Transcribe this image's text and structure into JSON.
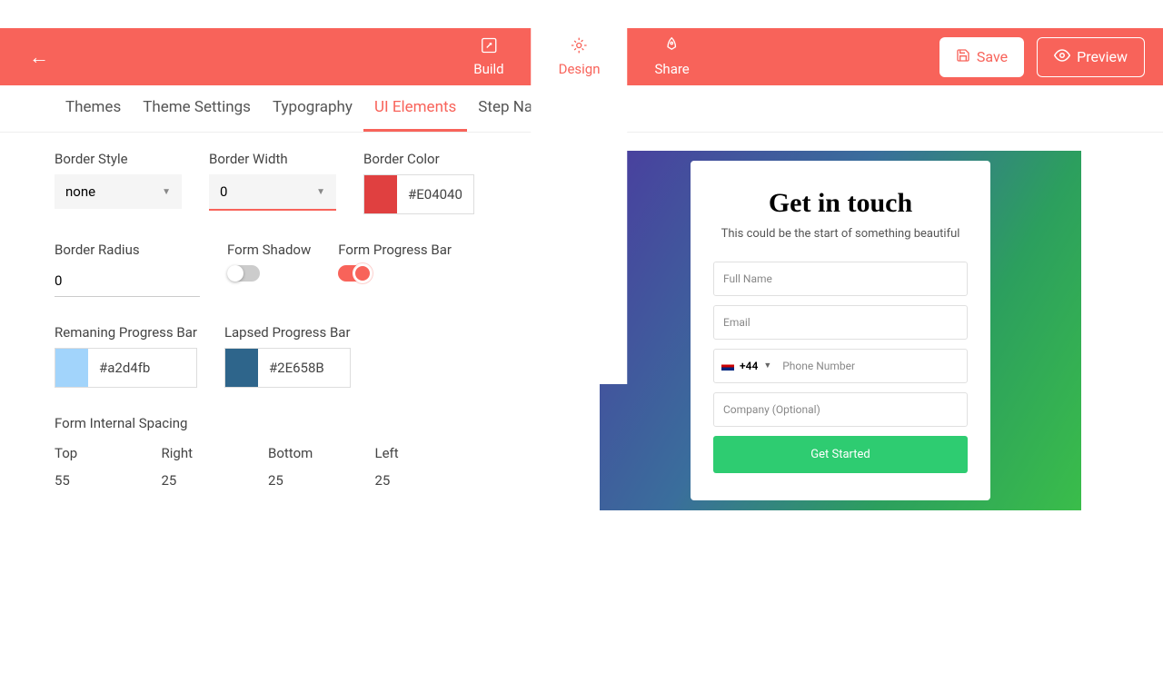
{
  "topbar": {
    "tabs": [
      {
        "label": "Build"
      },
      {
        "label": "Design"
      },
      {
        "label": "Share"
      }
    ],
    "save": "Save",
    "preview": "Preview"
  },
  "subnav": {
    "items": [
      "Themes",
      "Theme Settings",
      "Typography",
      "UI Elements",
      "Step Navigation"
    ]
  },
  "settings": {
    "border_style": {
      "label": "Border Style",
      "value": "none"
    },
    "border_width": {
      "label": "Border Width",
      "value": "0"
    },
    "border_color": {
      "label": "Border Color",
      "swatch": "#E04040",
      "value": "#E04040"
    },
    "border_radius": {
      "label": "Border Radius",
      "value": "0"
    },
    "form_shadow": {
      "label": "Form Shadow",
      "on": false
    },
    "form_progress": {
      "label": "Form Progress Bar",
      "on": true
    },
    "remaining_bar": {
      "label": "Remaning Progress Bar",
      "swatch": "#a2d4fb",
      "value": "#a2d4fb"
    },
    "lapsed_bar": {
      "label": "Lapsed Progress Bar",
      "swatch": "#2E658B",
      "value": "#2E658B"
    },
    "internal_spacing": {
      "label": "Form Internal Spacing",
      "cols": [
        {
          "label": "Top",
          "value": "55"
        },
        {
          "label": "Right",
          "value": "25"
        },
        {
          "label": "Bottom",
          "value": "25"
        },
        {
          "label": "Left",
          "value": "25"
        }
      ]
    }
  },
  "preview": {
    "title": "Get in touch",
    "subtitle": "This could be the start of something beautiful",
    "fields": {
      "full_name": "Full Name",
      "email": "Email",
      "phone_code": "+44",
      "phone_placeholder": "Phone Number",
      "company": "Company (Optional)"
    },
    "cta": "Get Started"
  }
}
